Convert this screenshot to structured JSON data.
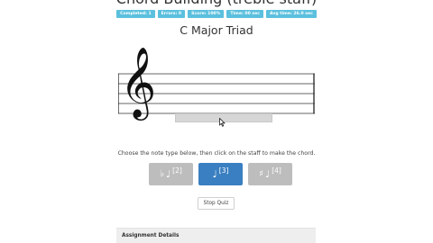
{
  "page": {
    "title": "Chord Building (treble staff)",
    "chord_name": "C Major Triad"
  },
  "stats": [
    {
      "label": "Completed: 1"
    },
    {
      "label": "Errors: 0"
    },
    {
      "label": "Score: 100%"
    },
    {
      "label": "Time: 00 sec"
    },
    {
      "label": "Avg time: 26.0 sec"
    }
  ],
  "staff": {
    "clef_icon": "treble-clef-icon",
    "clef_glyph": "𝄞"
  },
  "instructions": "Choose the note type below, then click on the staff to make the chord.",
  "note_buttons": [
    {
      "accidental": "♭",
      "note": "♩",
      "shortcut": "[2]",
      "state": "inactive"
    },
    {
      "accidental": "",
      "note": "♩",
      "shortcut": "[3]",
      "state": "active"
    },
    {
      "accidental": "♯",
      "note": "♩",
      "shortcut": "[4]",
      "state": "inactive"
    }
  ],
  "stop_button": {
    "label": "Stop Quiz"
  },
  "assignment": {
    "label": "Assignment Details"
  },
  "colors": {
    "stat_badge": "#5bc0de",
    "active_button": "#3a7fc1",
    "inactive_button": "#bdbdbd"
  }
}
